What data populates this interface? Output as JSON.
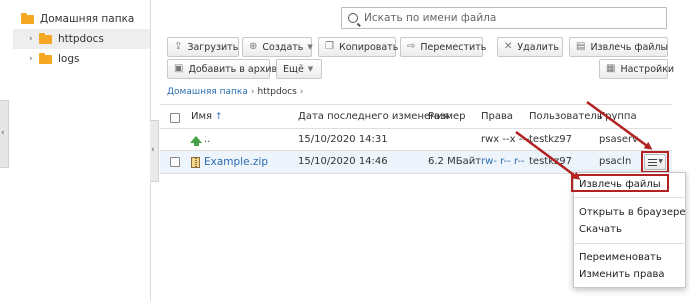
{
  "tree": {
    "root_label": "Домашняя папка",
    "items": [
      {
        "label": "httpdocs"
      },
      {
        "label": "logs"
      }
    ]
  },
  "search": {
    "placeholder": "Искать по имени файла"
  },
  "toolbar": {
    "upload": "Загрузить",
    "create": "Создать",
    "copy": "Копировать",
    "move": "Переместить",
    "delete": "Удалить",
    "extract": "Извлечь файлы",
    "archive": "Добавить в архив",
    "more": "Ещё",
    "settings": "Настройки"
  },
  "breadcrumb": {
    "root": "Домашняя папка",
    "current": "httpdocs"
  },
  "table": {
    "headers": {
      "name": "Имя",
      "modified": "Дата последнего изменения",
      "size": "Размер",
      "perms": "Права",
      "user": "Пользователь",
      "group": "Группа"
    },
    "rows": [
      {
        "name": "..",
        "modified": "15/10/2020 14:31",
        "size": "",
        "perms": "rwx --x ---",
        "user": "testkz97",
        "group": "psaserv"
      },
      {
        "name": "Example.zip",
        "modified": "15/10/2020 14:46",
        "size": "6.2 МБайт",
        "perms": "rw- r-- r--",
        "user": "testkz97",
        "group": "psacln"
      }
    ]
  },
  "context_menu": {
    "extract": "Извлечь файлы",
    "open_browser": "Открыть в браузере",
    "download": "Скачать",
    "rename": "Переименовать",
    "change_perms": "Изменить права"
  },
  "colors": {
    "accent_link": "#2b6db0",
    "highlight": "#b22222",
    "folder": "#f5a623",
    "up_arrow": "#43a047"
  }
}
